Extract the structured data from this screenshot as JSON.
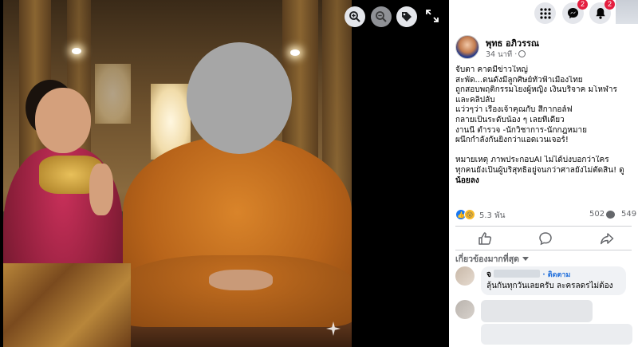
{
  "viewer": {
    "zoom_in_icon": "magnifier-plus-icon",
    "zoom_out_icon": "magnifier-minus-icon",
    "tag_icon": "tag-icon",
    "expand_icon": "expand-arrows-icon",
    "sparkle_icon": "ai-sparkle-icon"
  },
  "topbar": {
    "menu_icon": "grid-menu-icon",
    "messenger_icon": "messenger-icon",
    "messenger_badge": "2",
    "notifications_icon": "bell-icon",
    "notifications_badge": "2"
  },
  "post": {
    "author": "พุทธ อภิวรรณ",
    "time": "34 นาที ·",
    "lines": [
      "จับตา คาดมีข่าวใหญ่",
      "สะพัด...ดนดังมีลูกศิษย์ทั่วฟ้าเมืองไทย",
      "ถูกสอบพฤติกรรมโยงผู้หญิง เงินบริจาค มโหฬาร",
      "และคลิปลับ",
      "แว่วๆว่า เรื่องเจ้าคุณกับ สีกากอล์ฟ",
      "กลายเป็นระดับน้อง ๆ เลยทีเดียว",
      "งานนี้ ตำรวจ -นักวิชาการ-นักกฎหมาย",
      "ผนึกกำลังกันยิ่งกว่าแอดเวนเจอร์!",
      "",
      "หมายเหตุ ภาพประกอบAI ไม่ได้บ่งบอกว่าใคร",
      "ทุกคนยังเป็นผู้บริสุทธิ์อยู่จนกว่าศาลยังไม่ตัดสิน! ดู",
      "น้อยลง"
    ],
    "reactions_count": "5.3 พัน",
    "comments_count": "502",
    "shares_count": "549",
    "accent_color": "#1877f2"
  },
  "actions": {
    "like_icon": "thumbs-up-icon",
    "comment_icon": "comment-bubble-icon",
    "share_icon": "share-arrow-icon"
  },
  "comments": {
    "sort_label": "เกี่ยวข้องมากที่สุด",
    "first": {
      "name_initial": "จ",
      "follow_label": "· ติดตาม",
      "text": "ลุ้นกันทุกวันเลยครับ ละครลดรไม่ต้อง"
    }
  }
}
